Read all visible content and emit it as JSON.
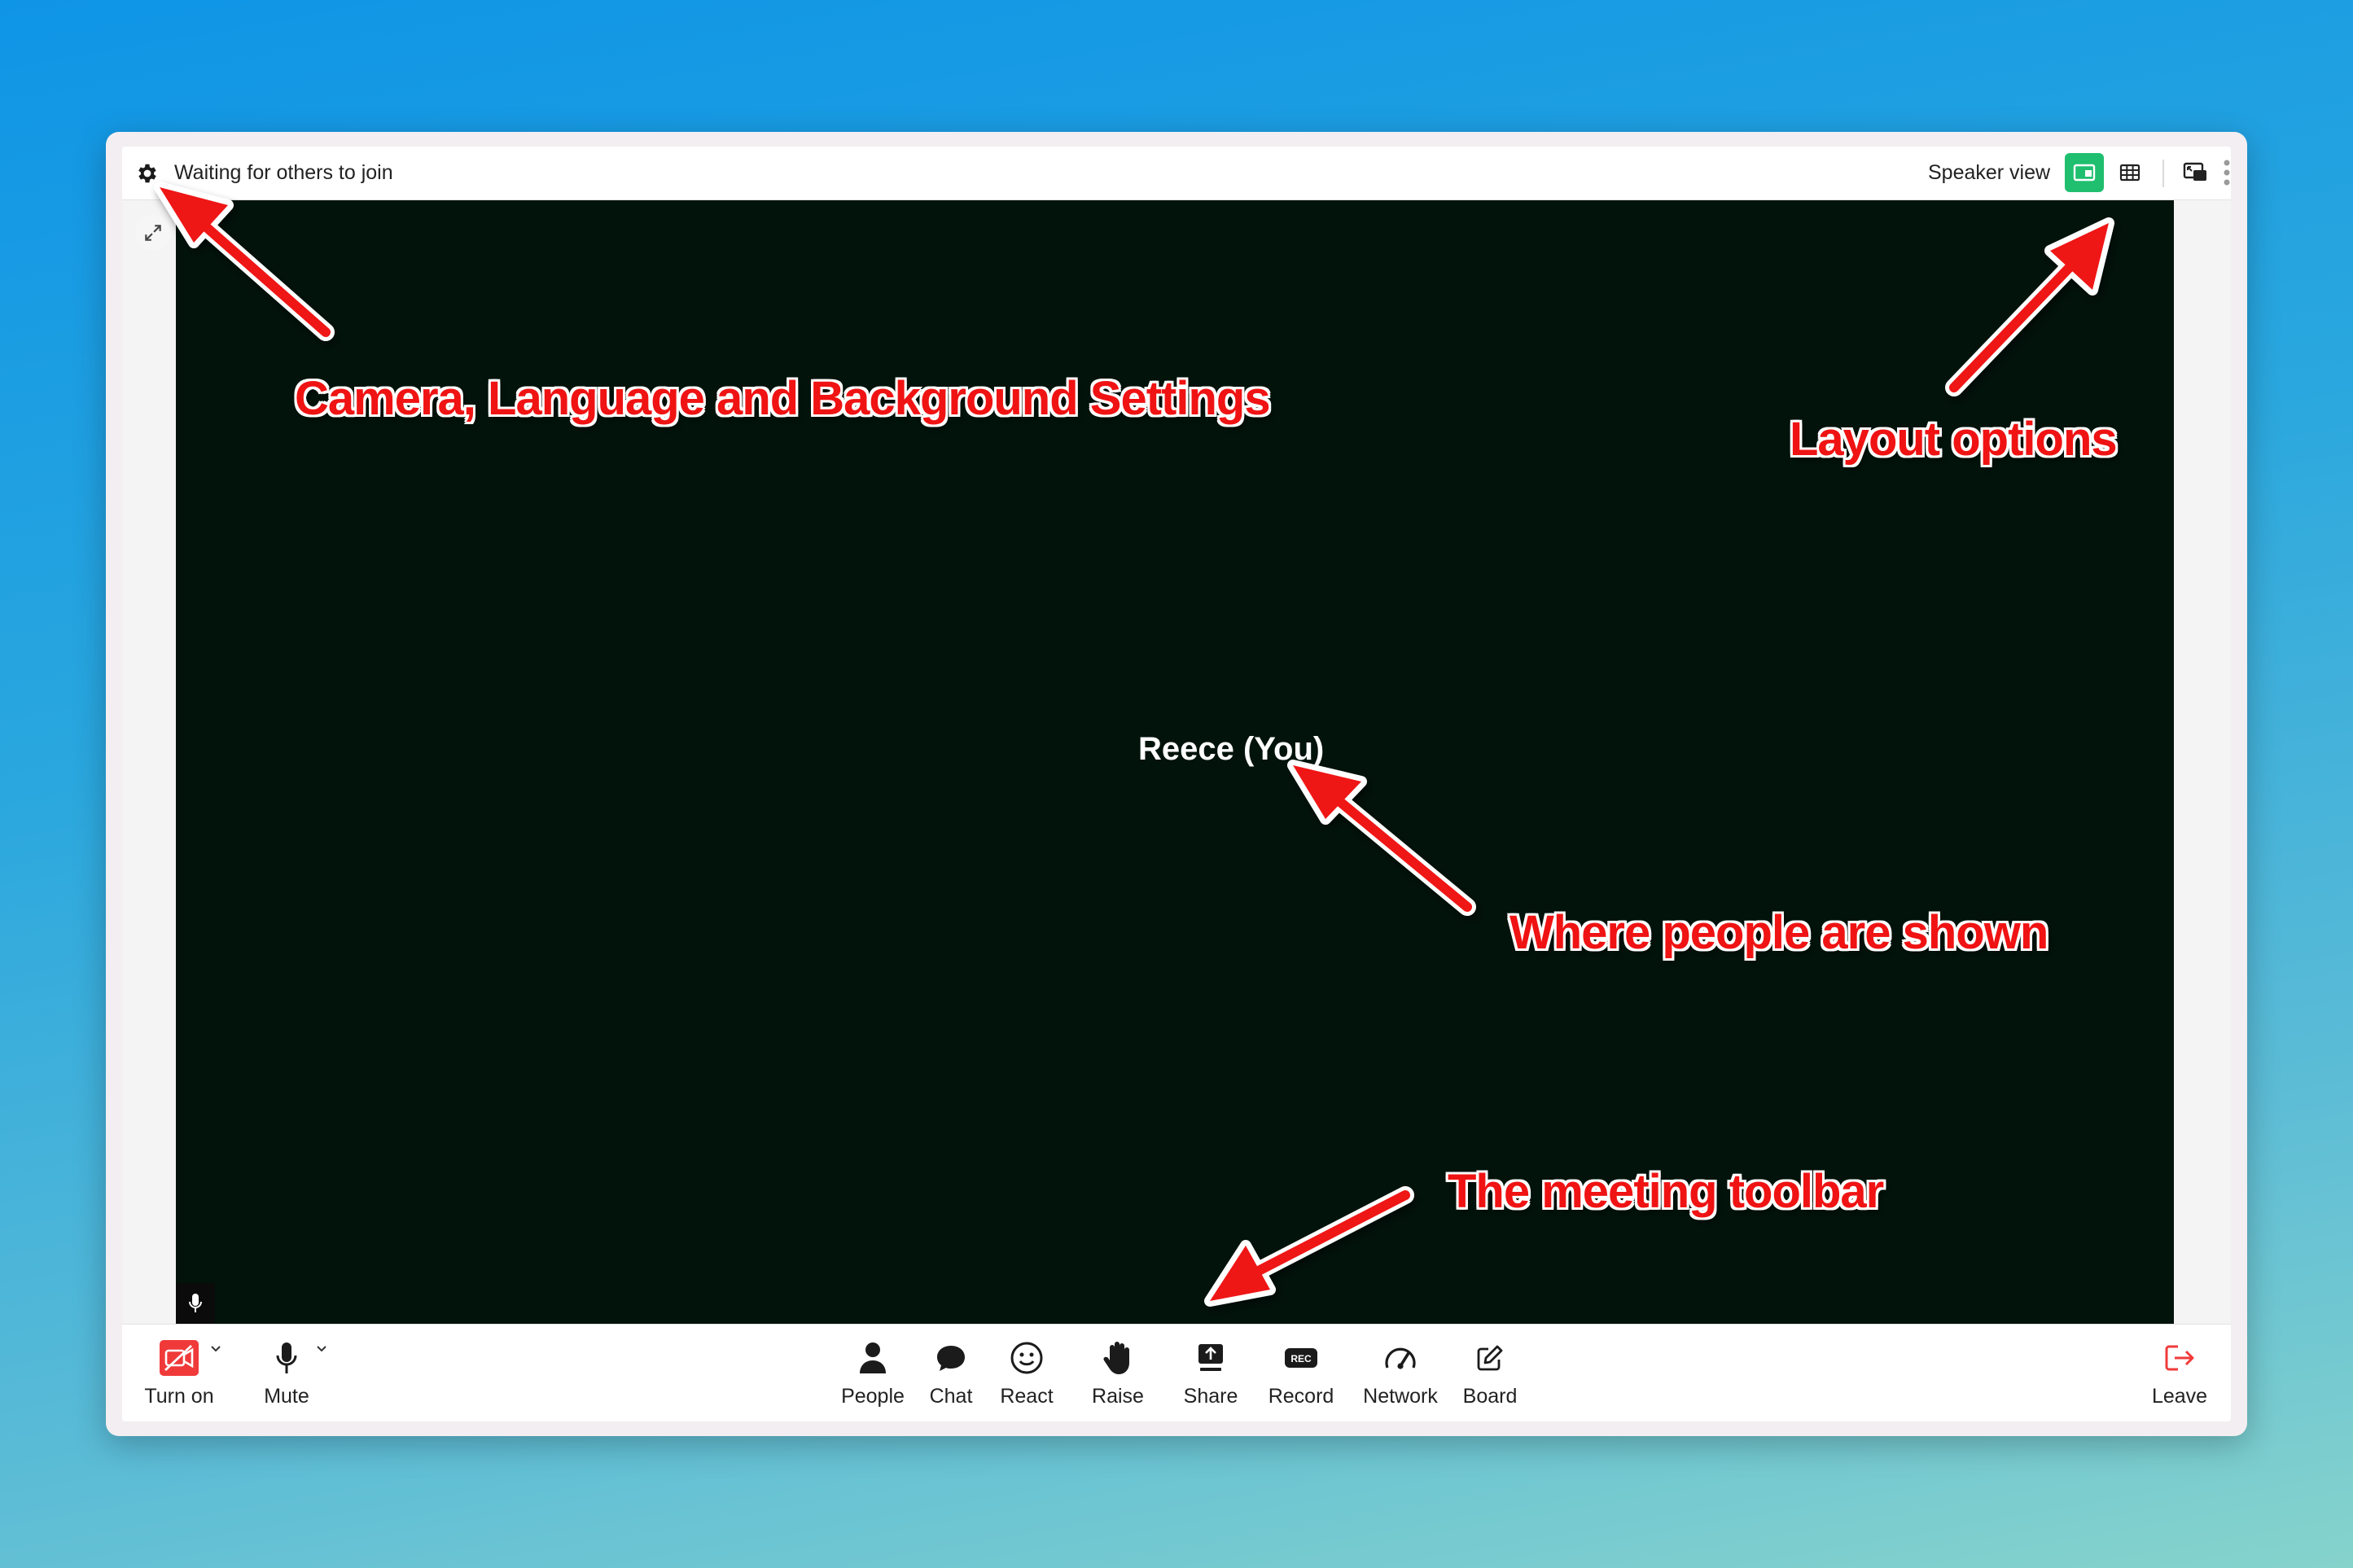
{
  "topbar": {
    "status": "Waiting for others to join",
    "layout_label": "Speaker view",
    "accent_color": "#1fbf6f"
  },
  "stage": {
    "participant_name": "Reece (You)",
    "background_color": "#02130c"
  },
  "toolbar": {
    "camera_label": "Turn on",
    "mic_label": "Mute",
    "people_label": "People",
    "chat_label": "Chat",
    "react_label": "React",
    "raise_label": "Raise",
    "share_label": "Share",
    "record_label": "Record",
    "network_label": "Network",
    "board_label": "Board",
    "leave_label": "Leave",
    "record_icon_text": "REC"
  },
  "annotations": {
    "settings": "Camera, Language and Background Settings",
    "layout": "Layout options",
    "people": "Where people are shown",
    "toolbar": "The meeting toolbar",
    "color": "#ef1313"
  }
}
